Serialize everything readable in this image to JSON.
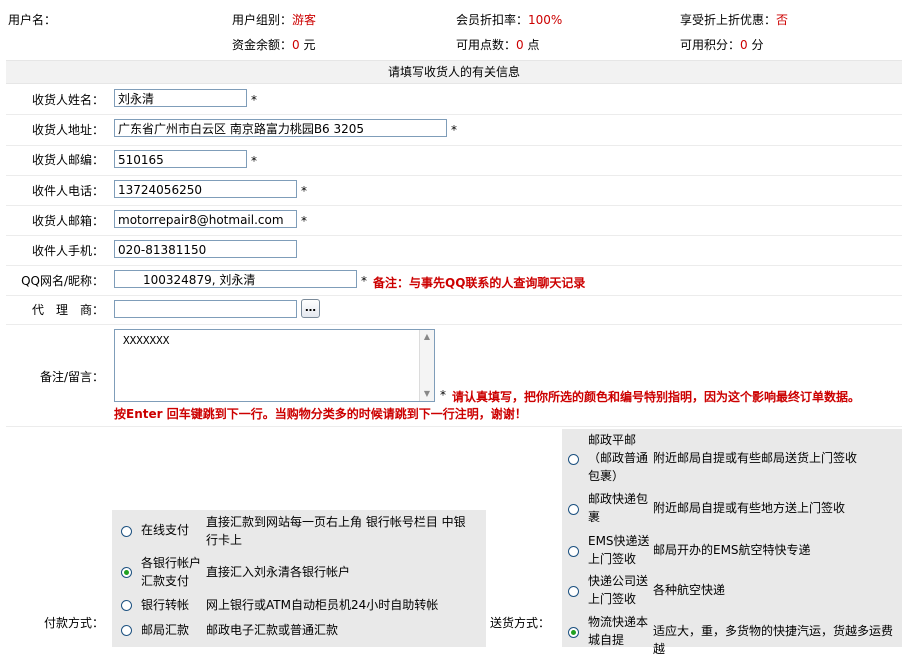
{
  "header": {
    "username_label": "用户名：",
    "user_group_label": "用户组别：",
    "user_group_value": "游客",
    "discount_label": "会员折扣率：",
    "discount_value": "100%",
    "extra_discount_label": "享受折上折优惠：",
    "extra_discount_value": "否",
    "balance_label": "资金余额：",
    "balance_value": "0",
    "balance_unit": "元",
    "points_label": "可用点数：",
    "points_value": "0",
    "points_unit": "点",
    "score_label": "可用积分：",
    "score_value": "0",
    "score_unit": "分"
  },
  "section_title": "请填写收货人的有关信息",
  "form": {
    "name": {
      "label": "收货人姓名：",
      "value": "刘永清",
      "star": "*"
    },
    "address": {
      "label": "收货人地址：",
      "value": "广东省广州市白云区 南京路富力桃园B6 3205",
      "star": "*"
    },
    "zip": {
      "label": "收货人邮编：",
      "value": "510165",
      "star": "*"
    },
    "phone": {
      "label": "收件人电话：",
      "value": "13724056250",
      "star": "*"
    },
    "email": {
      "label": "收货人邮箱：",
      "value": "motorrepair8@hotmail.com",
      "star": "*"
    },
    "mobile": {
      "label": "收件人手机：",
      "value": "020-81381150"
    },
    "qq": {
      "label": "QQ网名/昵称：",
      "value": "100324879, 刘永清",
      "star": "*",
      "note": "备注：与事先QQ联系的人查询聊天记录"
    },
    "agent": {
      "label": "代　理　商：",
      "value": "",
      "button": "…"
    },
    "remark": {
      "label": "备注/留言：",
      "value": "XXXXXXX",
      "star": "*",
      "note1": "请认真填写，把你所选的颜色和编号特别指明，因为这个影响最终订单数据。",
      "note2": "按Enter 回车键跳到下一行。当购物分类多的时候请跳到下一行注明，谢谢！"
    }
  },
  "payment": {
    "label": "付款方式：",
    "options": [
      {
        "name": "在线支付",
        "desc": "直接汇款到网站每一页右上角 银行帐号栏目 中银行卡上",
        "selected": false
      },
      {
        "name": "各银行帐户汇款支付",
        "desc": "直接汇入刘永清各银行帐户",
        "selected": true
      },
      {
        "name": "银行转帐",
        "desc": "网上银行或ATM自动柜员机24小时自助转帐",
        "selected": false
      },
      {
        "name": "邮局汇款",
        "desc": "邮政电子汇款或普通汇款",
        "selected": false
      }
    ]
  },
  "shipping": {
    "label": "送货方式：",
    "options": [
      {
        "name": "邮政平邮（邮政普通包裹）",
        "desc": "附近邮局自提或有些邮局送货上门签收",
        "selected": false
      },
      {
        "name": "邮政快递包裹",
        "desc": "附近邮局自提或有些地方送上门签收",
        "selected": false
      },
      {
        "name": "EMS快递送上门签收",
        "desc": "邮局开办的EMS航空特快专递",
        "selected": false
      },
      {
        "name": "快递公司送上门签收",
        "desc": "各种航空快递",
        "selected": false
      },
      {
        "name": "物流快递本城自提",
        "desc": "适应大，重，多货物的快捷汽运，货越多运费越",
        "selected": true
      }
    ]
  }
}
